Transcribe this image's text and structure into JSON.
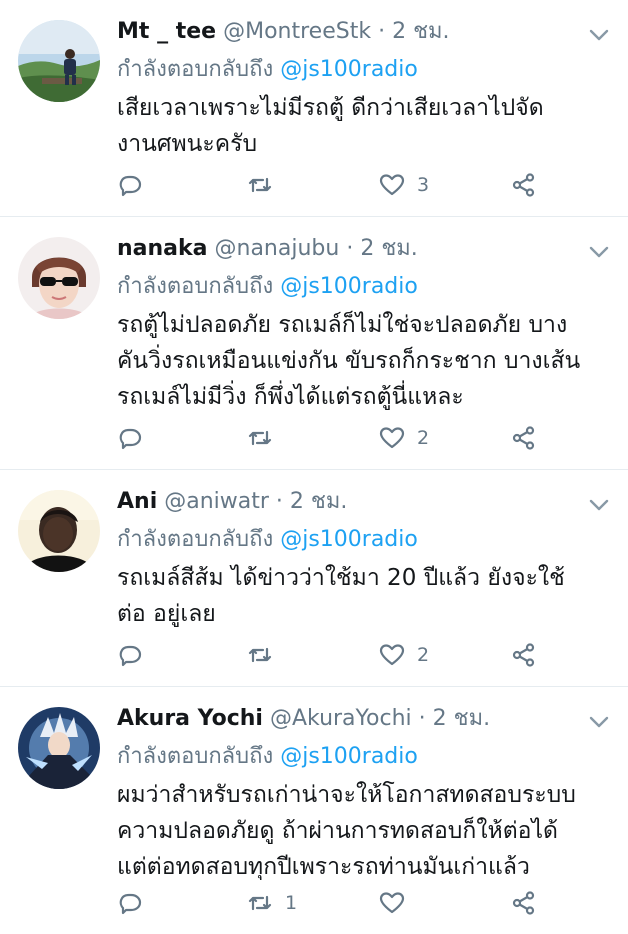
{
  "reply_prefix": "กำลังตอบกลับถึง",
  "tweets": [
    {
      "name": "Mt _ tee",
      "handle": "@MontreeStk",
      "separator": "·",
      "time": "2 ชม.",
      "mention": "@js100radio",
      "lines": [
        "เสียเวลาเพราะไม่มีรถตู้ ดีกว่าเสียเวลาไปจัด",
        "งานศพนะครับ"
      ],
      "retweets": "",
      "likes": "3",
      "avatar_icon": "landscape-photo-avatar"
    },
    {
      "name": "nanaka",
      "handle": "@nanajubu",
      "separator": "·",
      "time": "2 ชม.",
      "mention": "@js100radio",
      "lines": [
        "รถตู้ไม่ปลอดภัย รถเมล์ก็ไม่ใช่จะปลอดภัย บาง",
        "คันวิ่งรถเหมือนแข่งกัน ขับรถก็กระชาก บางเส้น",
        "รถเมล์ไม่มีวิ่ง ก็พึ่งได้แต่รถตู้นี่แหละ"
      ],
      "retweets": "",
      "likes": "2",
      "avatar_icon": "sunglasses-person-avatar"
    },
    {
      "name": "Ani",
      "handle": "@aniwatr",
      "separator": "·",
      "time": "2 ชม.",
      "mention": "@js100radio",
      "lines": [
        "รถเมล์สีส้ม ได้ข่าวว่าใช้มา 20 ปีแล้ว ยังจะใช้",
        "ต่อ อยู่เลย"
      ],
      "retweets": "",
      "likes": "2",
      "avatar_icon": "selfie-person-avatar"
    },
    {
      "name": "Akura Yochi",
      "handle": "@AkuraYochi",
      "separator": "·",
      "time": "2 ชม.",
      "mention": "@js100radio",
      "lines": [
        "ผมว่าสำหรับรถเก่าน่าจะให้โอกาสทดสอบระบบ",
        "ความปลอดภัยดู ถ้าผ่านการทดสอบก็ให้ต่อได้",
        "แต่ต่อทดสอบทุกปีเพราะรถท่านมันเก่าแล้ว"
      ],
      "retweets": "1",
      "likes": "",
      "avatar_icon": "anime-character-avatar"
    }
  ],
  "colors": {
    "name": "#14171a",
    "secondary": "#657786",
    "mention": "#1da1f2",
    "divider": "#e6ecf0"
  }
}
